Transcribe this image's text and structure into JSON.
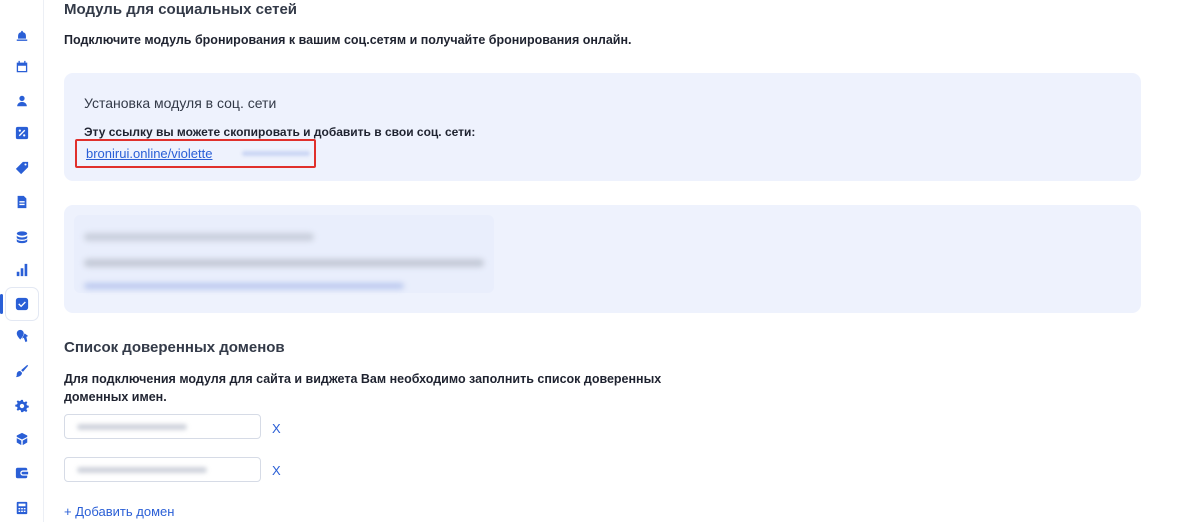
{
  "sidebar": {
    "items": [
      {
        "icon": "bell-icon"
      },
      {
        "icon": "calendar-icon"
      },
      {
        "icon": "user-icon"
      },
      {
        "icon": "percent-icon"
      },
      {
        "icon": "tag-icon"
      },
      {
        "icon": "document-icon"
      },
      {
        "icon": "coins-icon"
      },
      {
        "icon": "bar-chart-icon"
      },
      {
        "icon": "check-badge-icon",
        "active": true
      },
      {
        "icon": "pin-icon"
      },
      {
        "icon": "brush-icon"
      },
      {
        "icon": "gear-icon"
      },
      {
        "icon": "box-icon"
      },
      {
        "icon": "wallet-icon"
      },
      {
        "icon": "calculator-icon"
      }
    ],
    "accent": "#2a5fd6"
  },
  "social": {
    "title": "Модуль для социальных сетей",
    "description": "Подключите модуль бронирования к вашим соц.сетям и получайте бронирования онлайн."
  },
  "install_card": {
    "title": "Установка модуля в соц. сети",
    "text": "Эту ссылку вы можете скопировать и добавить в свои соц. сети:",
    "link": "bronirui.online/violette",
    "highlight_color": "#e0302c"
  },
  "domains": {
    "title": "Список доверенных доменов",
    "description_line1": "Для подключения модуля для сайта и виджета Вам необходимо заполнить список доверенных",
    "description_line2": "доменных имен.",
    "remove_label": "X",
    "add_label": "+ Добавить домен"
  },
  "colors": {
    "card_bg": "#eef2fd",
    "link": "#2a5fd6",
    "text": "#333a48"
  }
}
